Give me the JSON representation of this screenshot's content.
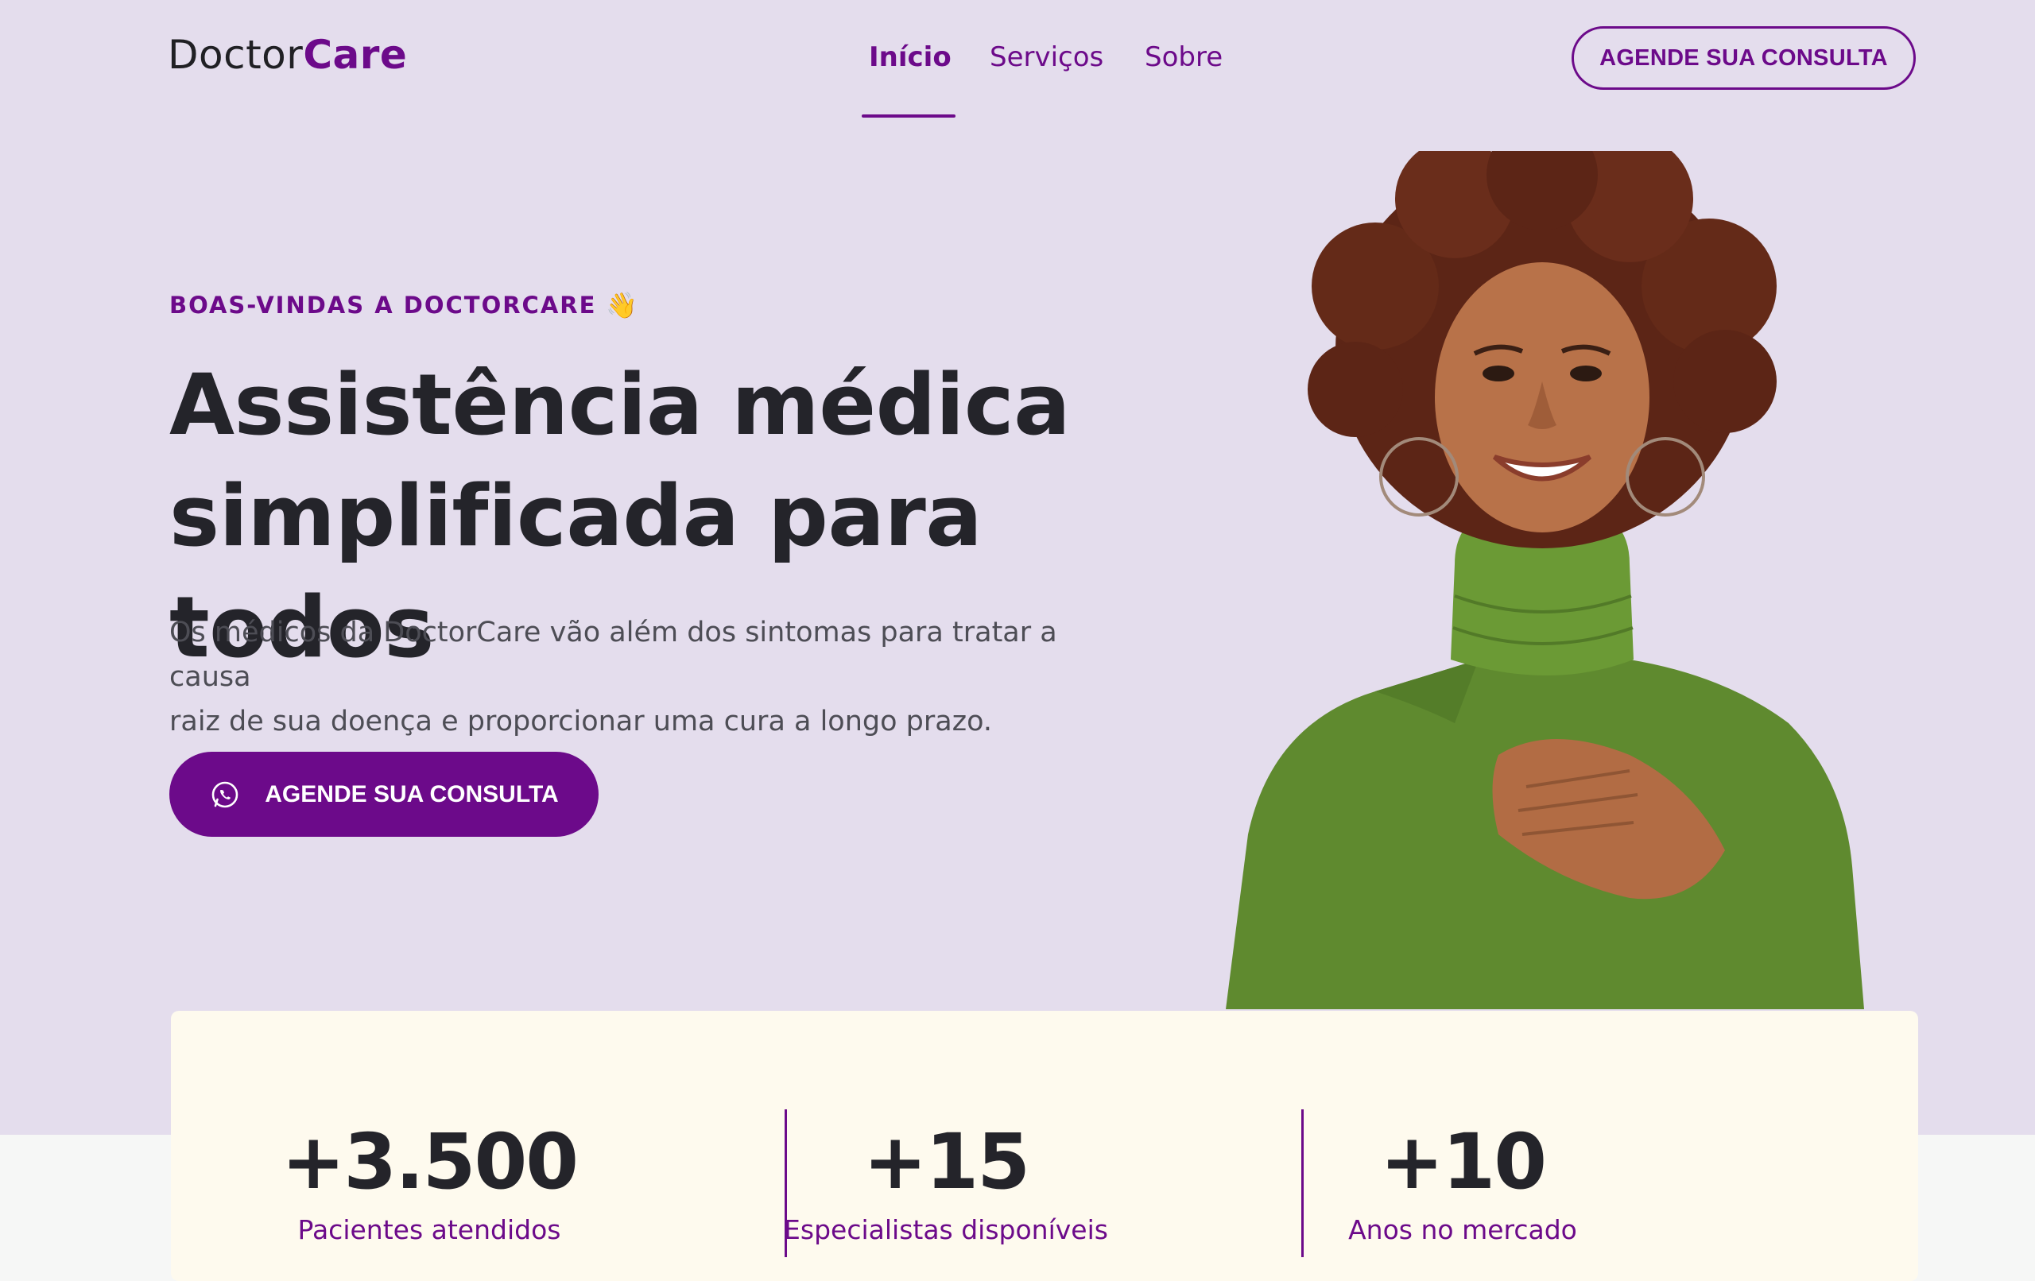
{
  "brand": {
    "name_part1": "Doctor",
    "name_part2": "Care"
  },
  "nav": {
    "items": [
      {
        "label": "Início",
        "active": true
      },
      {
        "label": "Serviços",
        "active": false
      },
      {
        "label": "Sobre",
        "active": false
      }
    ],
    "cta_label": "AGENDE SUA CONSULTA"
  },
  "hero": {
    "eyebrow": "BOAS-VINDAS A DOCTORCARE",
    "eyebrow_icon": "waving-hand",
    "title_line1": "Assistência médica",
    "title_line2": "simplificada para todos",
    "description_line1": "Os médicos da DoctorCare vão além dos sintomas para tratar a causa",
    "description_line2": "raiz de sua doença e proporcionar uma cura a longo prazo.",
    "cta_label": "AGENDE SUA CONSULTA",
    "cta_icon": "whatsapp-icon"
  },
  "stats": [
    {
      "value": "+3.500",
      "label": "Pacientes atendidos"
    },
    {
      "value": "+15",
      "label": "Especialistas disponíveis"
    },
    {
      "value": "+10",
      "label": "Anos no mercado"
    }
  ],
  "colors": {
    "primary": "#6c0a8a",
    "hero_bg": "#e4dded",
    "card_bg": "#fefaee",
    "heading": "#24242a"
  }
}
